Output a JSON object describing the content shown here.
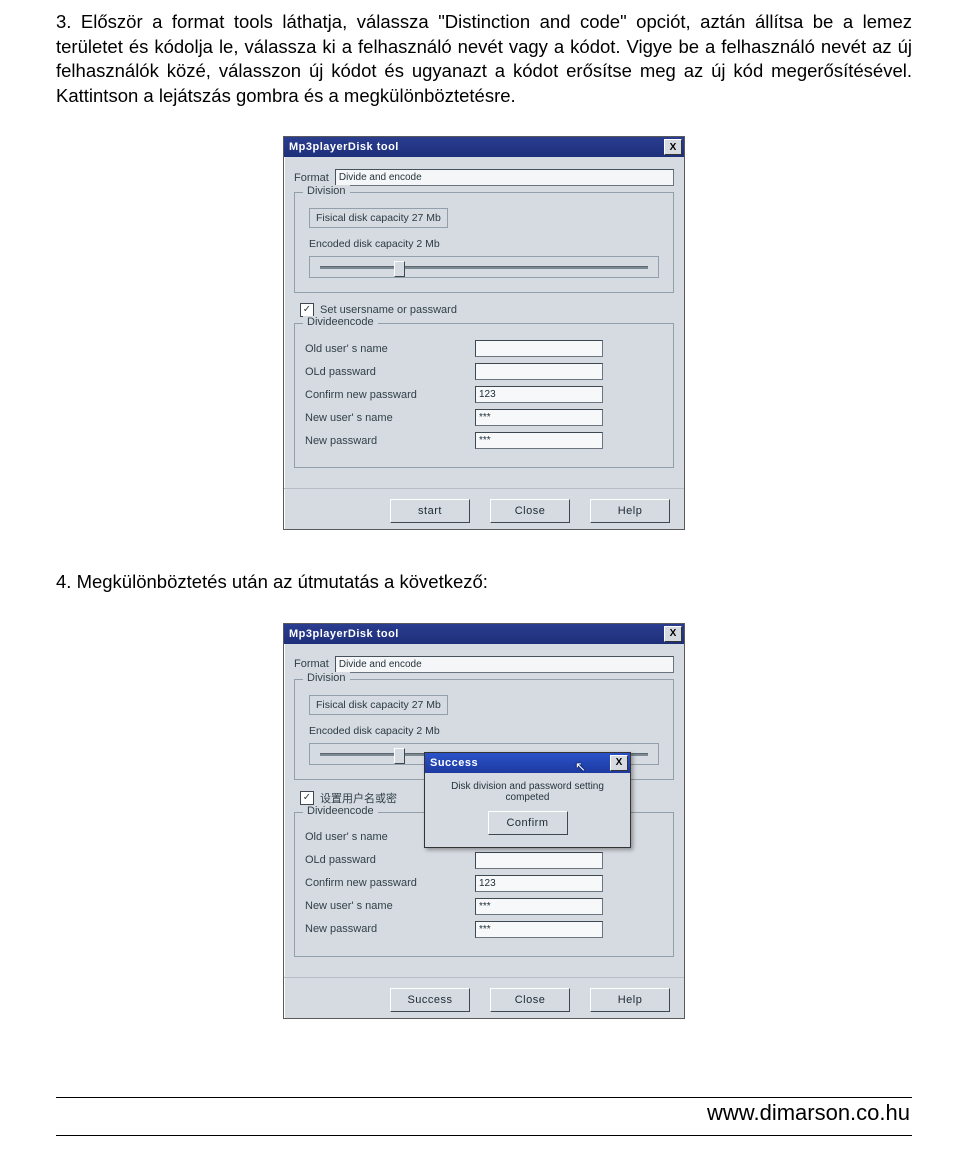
{
  "doc": {
    "para3": "3. Először a format tools láthatja, válassza   \"Distinction and code\" opciót, aztán állítsa be a lemez területet és kódolja le, válassza ki a felhasználó nevét  vagy a kódot. Vigye be a felhasználó nevét az új felhasználók közé, válasszon új kódot és ugyanazt a kódot erősítse meg az új kód megerősítésével. Kattintson a lejátszás gombra és a megkülönböztetésre.",
    "para4": "4. Megkülönböztetés után az útmutatás a következő:",
    "footer_url": "www.dimarson.co.hu"
  },
  "win": {
    "title": "Mp3playerDisk tool",
    "closeX": "X",
    "format_label": "Format",
    "format_value": "Divide and encode",
    "division_label": "Division",
    "physical": "Fisical disk capacity 27   Mb",
    "encoded": "Encoded disk capacity 2   Mb",
    "checkbox_label": "Set usersname or passward",
    "checkbox_label_cn": "设置用户名或密",
    "encode_group": "Divideencode",
    "old_user": "Old user' s name",
    "old_pw": "OLd passward",
    "confirm_pw": "Confirm new passward",
    "new_user": "New user' s name",
    "new_pw": "New passward",
    "val_confirm": "123",
    "val_new_user": "***",
    "val_new_pw": "***",
    "btn_start": "start",
    "btn_success": "Success",
    "btn_close": "Close",
    "btn_help": "Help"
  },
  "modal": {
    "title": "Success",
    "msg": "Disk division and password setting competed",
    "confirm": "Confirm"
  }
}
